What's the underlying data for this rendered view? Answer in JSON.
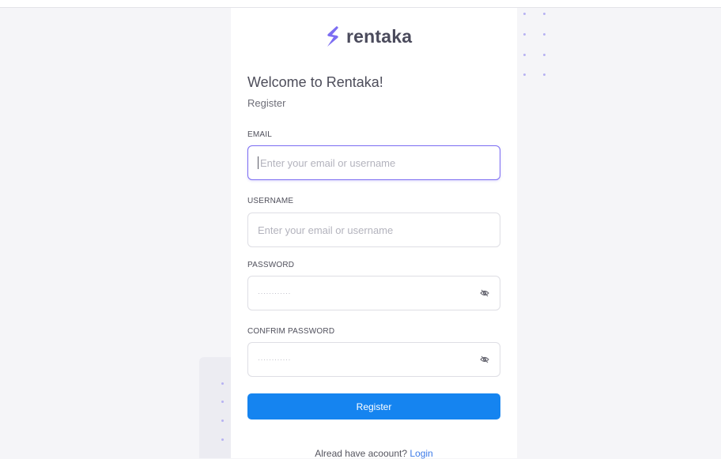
{
  "brand": {
    "name": "rentaka",
    "logo_icon": "s-bolt-logo-icon",
    "accent_color": "#7c6df2"
  },
  "header": {
    "welcome": "Welcome to Rentaka!",
    "subtitle": "Register"
  },
  "form": {
    "email": {
      "label": "EMAIL",
      "placeholder": "Enter your email or username",
      "value": ""
    },
    "username": {
      "label": "USERNAME",
      "placeholder": "Enter your email or username",
      "value": ""
    },
    "password": {
      "label": "PASSWORD",
      "masked_value": "············",
      "toggle_icon": "eye-off-icon"
    },
    "confirm_password": {
      "label": "CONFRIM PASSWORD",
      "masked_value": "············",
      "toggle_icon": "eye-off-icon"
    },
    "submit_label": "Register",
    "submit_color": "#1584f0"
  },
  "footer": {
    "prompt": "Alread have acoount?",
    "link": "Login",
    "link_color": "#3d7be8"
  }
}
